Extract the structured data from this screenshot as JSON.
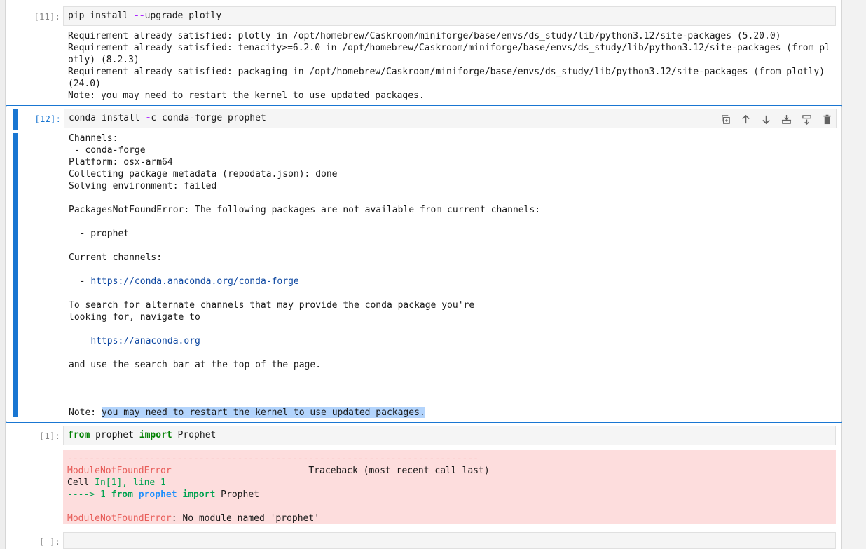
{
  "cells": [
    {
      "prompt": "[11]:",
      "source": "pip install --upgrade plotly",
      "output": [
        "Requirement already satisfied: plotly in /opt/homebrew/Caskroom/miniforge/base/envs/ds_study/lib/python3.12/site-packages (5.20.0)",
        "Requirement already satisfied: tenacity>=6.2.0 in /opt/homebrew/Caskroom/miniforge/base/envs/ds_study/lib/python3.12/site-packages (from pl",
        "otly) (8.2.3)",
        "Requirement already satisfied: packaging in /opt/homebrew/Caskroom/miniforge/base/envs/ds_study/lib/python3.12/site-packages (from plotly)",
        "(24.0)",
        "Note: you may need to restart the kernel to use updated packages."
      ]
    },
    {
      "prompt": "[12]:",
      "source": "conda install -c conda-forge prophet",
      "output_lines": [
        "Channels:",
        " - conda-forge",
        "Platform: osx-arm64",
        "Collecting package metadata (repodata.json): done",
        "Solving environment: failed",
        "",
        "PackagesNotFoundError: The following packages are not available from current channels:",
        "",
        "  - prophet",
        "",
        "Current channels:",
        ""
      ],
      "channel_url": "https://conda.anaconda.org/conda-forge",
      "search_text_1": "To search for alternate channels that may provide the conda package you're",
      "search_text_2": "looking for, navigate to",
      "anaconda_url": "https://anaconda.org",
      "search_bar_text": "and use the search bar at the top of the page.",
      "note_prefix": "Note: ",
      "note_highlight": "you may need to restart the kernel to use updated packages."
    },
    {
      "prompt": "[1]:",
      "source_from": "from",
      "source_module": " prophet ",
      "source_import": "import",
      "source_name": " Prophet",
      "error": {
        "dashes": "---------------------------------------------------------------------------",
        "name": "ModuleNotFoundError",
        "traceback_label": "                         Traceback (most recent call last)",
        "cell_prefix": "Cell ",
        "cell_ref": "In[1], line 1",
        "arrow": "----> 1 ",
        "kw_from": "from",
        "kw_module": " prophet ",
        "kw_import": "import",
        "kw_name": " Prophet",
        "final_name": "ModuleNotFoundError",
        "final_msg": ": No module named 'prophet'"
      }
    },
    {
      "prompt": "[ ]:"
    }
  ],
  "toolbar": {
    "duplicate": "copy-icon",
    "move_up": "arrow-up-icon",
    "move_down": "arrow-down-icon",
    "insert_above": "insert-above-icon",
    "insert_below": "insert-below-icon",
    "delete": "trash-icon"
  }
}
